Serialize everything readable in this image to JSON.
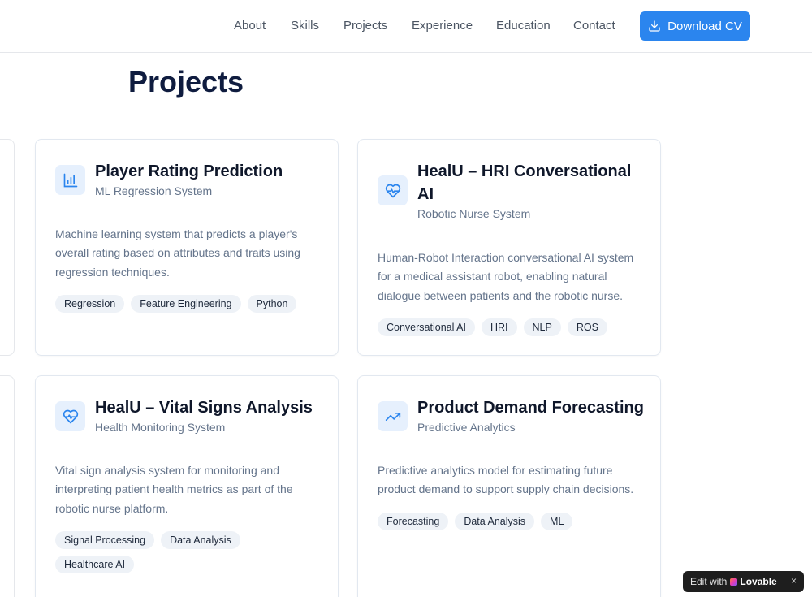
{
  "nav": {
    "links": [
      "About",
      "Skills",
      "Projects",
      "Experience",
      "Education",
      "Contact"
    ],
    "cv_button": "Download CV"
  },
  "section": {
    "title": "Projects"
  },
  "projects": [
    {
      "icon": "bar-chart-icon",
      "title": "Player Rating Prediction",
      "subtitle": "ML Regression System",
      "description": "Machine learning system that predicts a player's overall rating based on attributes and traits using regression techniques.",
      "tags": [
        "Regression",
        "Feature Engineering",
        "Python"
      ]
    },
    {
      "icon": "heart-pulse-icon",
      "title": "HealU – HRI Conversational AI",
      "subtitle": "Robotic Nurse System",
      "description": "Human-Robot Interaction conversational AI system for a medical assistant robot, enabling natural dialogue between patients and the robotic nurse.",
      "tags": [
        "Conversational AI",
        "HRI",
        "NLP",
        "ROS"
      ]
    },
    {
      "icon": "heart-pulse-icon",
      "title": "HealU – Vital Signs Analysis",
      "subtitle": "Health Monitoring System",
      "description": "Vital sign analysis system for monitoring and interpreting patient health metrics as part of the robotic nurse platform.",
      "tags": [
        "Signal Processing",
        "Data Analysis",
        "Healthcare AI"
      ]
    },
    {
      "icon": "trending-up-icon",
      "title": "Product Demand Forecasting",
      "subtitle": "Predictive Analytics",
      "description": "Predictive analytics model for estimating future product demand to support supply chain decisions.",
      "tags": [
        "Forecasting",
        "Data Analysis",
        "ML"
      ]
    }
  ],
  "badge": {
    "prefix": "Edit with",
    "brand": "Lovable",
    "close": "×"
  },
  "colors": {
    "accent": "#2b85ee",
    "icon_bg": "#e6f0fd",
    "tag_bg": "#eef2f7",
    "title": "#0f1c3f"
  }
}
